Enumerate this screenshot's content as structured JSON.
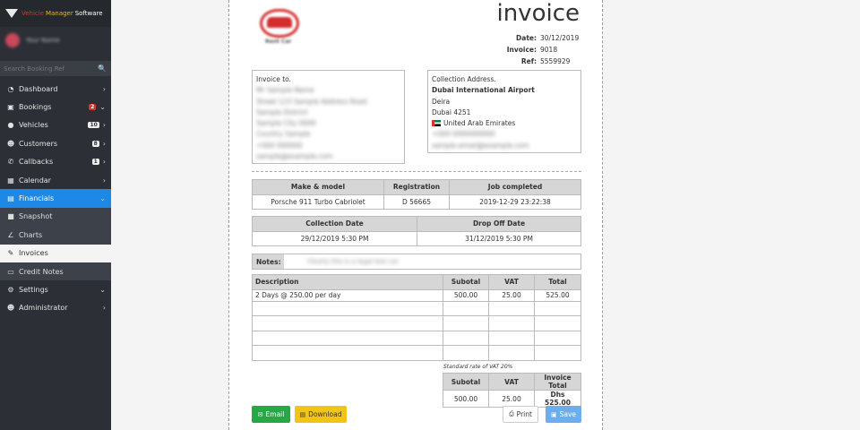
{
  "app": {
    "brand_part1": "Vehicle",
    "brand_part2": "Manager",
    "brand_part3": "Software",
    "user_name": "Your Name",
    "search_placeholder": "Search Booking Ref"
  },
  "menu": [
    {
      "label": "Dashboard",
      "icon": "dashboard-icon"
    },
    {
      "label": "Bookings",
      "icon": "bookings-icon",
      "badge": "2"
    },
    {
      "label": "Vehicles",
      "icon": "car-icon",
      "badge": "10"
    },
    {
      "label": "Customers",
      "icon": "user-icon",
      "badge": "8"
    },
    {
      "label": "Callbacks",
      "icon": "phone-icon",
      "badge": "1"
    },
    {
      "label": "Calendar",
      "icon": "calendar-icon"
    },
    {
      "label": "Financials",
      "icon": "chart-icon"
    },
    {
      "label": "Snapshot",
      "icon": "snapshot-icon"
    },
    {
      "label": "Charts",
      "icon": "line-chart-icon"
    },
    {
      "label": "Invoices",
      "icon": "invoice-icon"
    },
    {
      "label": "Credit Notes",
      "icon": "credit-note-icon"
    },
    {
      "label": "Settings",
      "icon": "gear-icon"
    },
    {
      "label": "Administrator",
      "icon": "user-icon"
    }
  ],
  "invoice": {
    "title": "invoice",
    "date_label": "Date:",
    "date": "30/12/2019",
    "invoice_label": "Invoice:",
    "invoice_no": "9018",
    "ref_label": "Ref:",
    "ref": "5559929",
    "company_logo_text": "Rent Car",
    "invoice_to_label": "Invoice to.",
    "invoice_to_lines": [
      "Mr Sample Name",
      "Street 123 Sample Address Road",
      "Sample District",
      "Sample City 0000",
      "Country Sample",
      "+000 000000",
      "sample@example.com"
    ],
    "collection_label": "Collection Address.",
    "collection_name": "Dubai International Airport",
    "collection_line1": "Deira",
    "collection_line2": "Dubai 4251",
    "collection_country": "United Arab Emirates",
    "collection_phone": "+000 0000000000",
    "collection_email": "sample.email@example.com",
    "vehicle_headers": [
      "Make & model",
      "Registration",
      "Job completed"
    ],
    "vehicle_row": [
      "Porsche 911 Turbo Cabriolet",
      "D 56665",
      "2019-12-29 23:22:38"
    ],
    "date_headers": [
      "Collection Date",
      "Drop Off Date"
    ],
    "date_row": [
      "29/12/2019 5:30 PM",
      "31/12/2019 5:30 PM"
    ],
    "notes_label": "Notes:",
    "notes_value": "Clearly this is a legal test car",
    "line_headers": [
      "Description",
      "Subotal",
      "VAT",
      "Total"
    ],
    "line_items": [
      [
        "2 Days @ 250.00 per day",
        "500.00",
        "25.00",
        "525.00"
      ]
    ],
    "vat_note": "Standard rate of VAT 20%",
    "totals_headers": [
      "Subotal",
      "VAT",
      "Invoice Total"
    ],
    "totals": [
      "500.00",
      "25.00",
      "Dhs 525.00"
    ],
    "email_label": "Email",
    "download_label": "Download",
    "print_label": "Print",
    "save_label": "Save"
  },
  "colors": {
    "sidebar": "#2c3036",
    "accent": "#1e88e5",
    "email": "#28a745",
    "download": "#f0c419",
    "save": "#6aaef0"
  }
}
